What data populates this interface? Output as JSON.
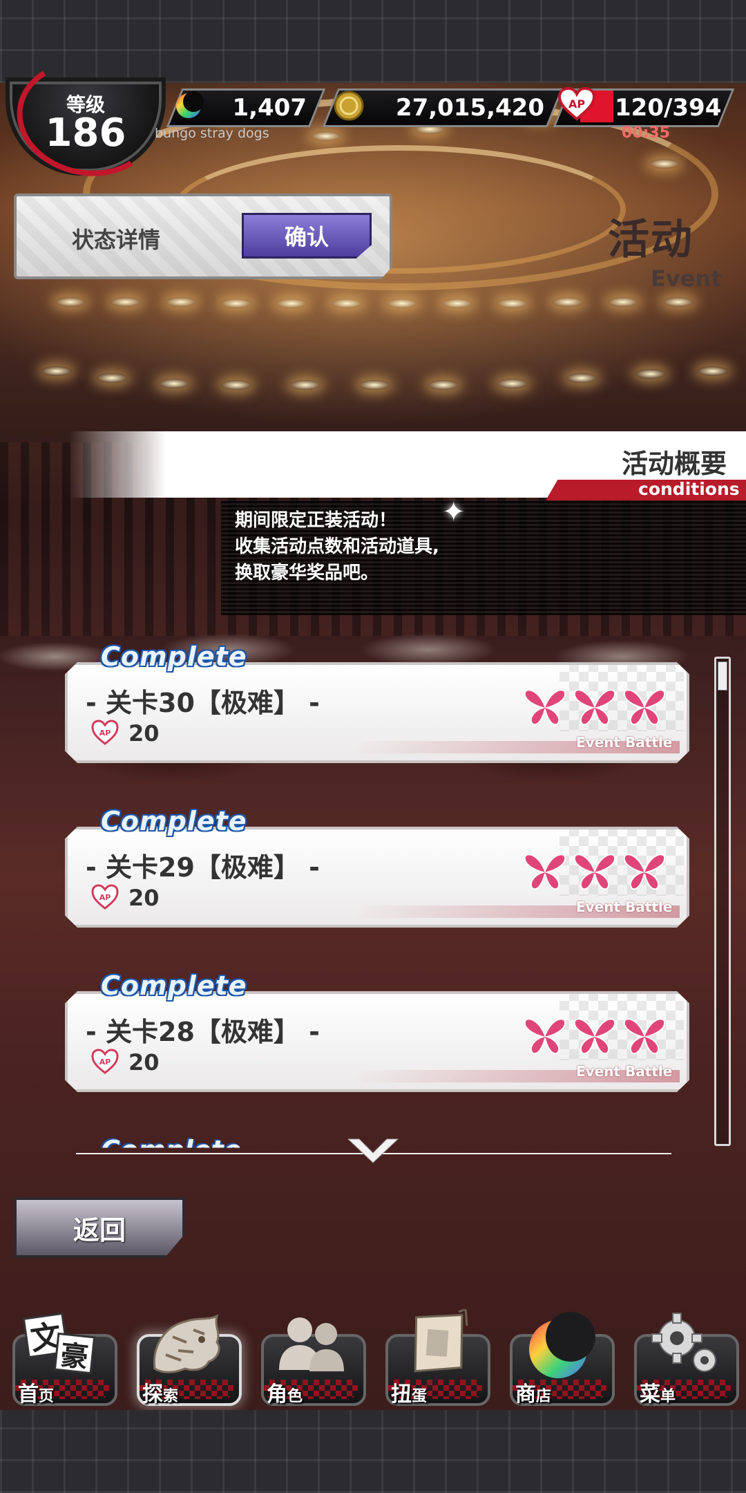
{
  "header": {
    "level_label": "等级",
    "level_value": "186",
    "crystals": "1,407",
    "coins": "27,015,420",
    "ap": "120/394",
    "ap_timer": "00:35",
    "game_title": "bungo stray dogs"
  },
  "status_panel": {
    "label": "状态详情",
    "confirm_label": "确认"
  },
  "page_title": {
    "cn": "活动",
    "en": "Event"
  },
  "summary": {
    "title": "活动概要",
    "subtitle": "conditions",
    "lines": [
      "期间限定正装活动！",
      "收集活动点数和活动道具,",
      "换取豪华奖品吧。"
    ]
  },
  "stages": [
    {
      "status": "Complete",
      "name": "- 关卡30【极难】 -",
      "cost": "20",
      "tag": "Event Battle",
      "rating": 3
    },
    {
      "status": "Complete",
      "name": "- 关卡29【极难】 -",
      "cost": "20",
      "tag": "Event Battle",
      "rating": 3
    },
    {
      "status": "Complete",
      "name": "- 关卡28【极难】 -",
      "cost": "20",
      "tag": "Event Battle",
      "rating": 3
    }
  ],
  "partial_stage_status": "Complete",
  "back_label": "返回",
  "nav": [
    {
      "label_big": "首",
      "label_small": "页",
      "icon": "home-kanji-icon"
    },
    {
      "label_big": "探",
      "label_small": "索",
      "icon": "tiger-icon",
      "active": true
    },
    {
      "label_big": "角",
      "label_small": "色",
      "icon": "people-icon"
    },
    {
      "label_big": "扭",
      "label_small": "蛋",
      "icon": "book-icon"
    },
    {
      "label_big": "商",
      "label_small": "店",
      "icon": "crescent-icon"
    },
    {
      "label_big": "菜",
      "label_small": "单",
      "icon": "gear-icon"
    }
  ],
  "colors": {
    "accent_red": "#c2162b",
    "confirm_purple": "#5b4bb0",
    "complete_blue": "#1f4f9c",
    "butterfly_pink": "#e0457a"
  }
}
